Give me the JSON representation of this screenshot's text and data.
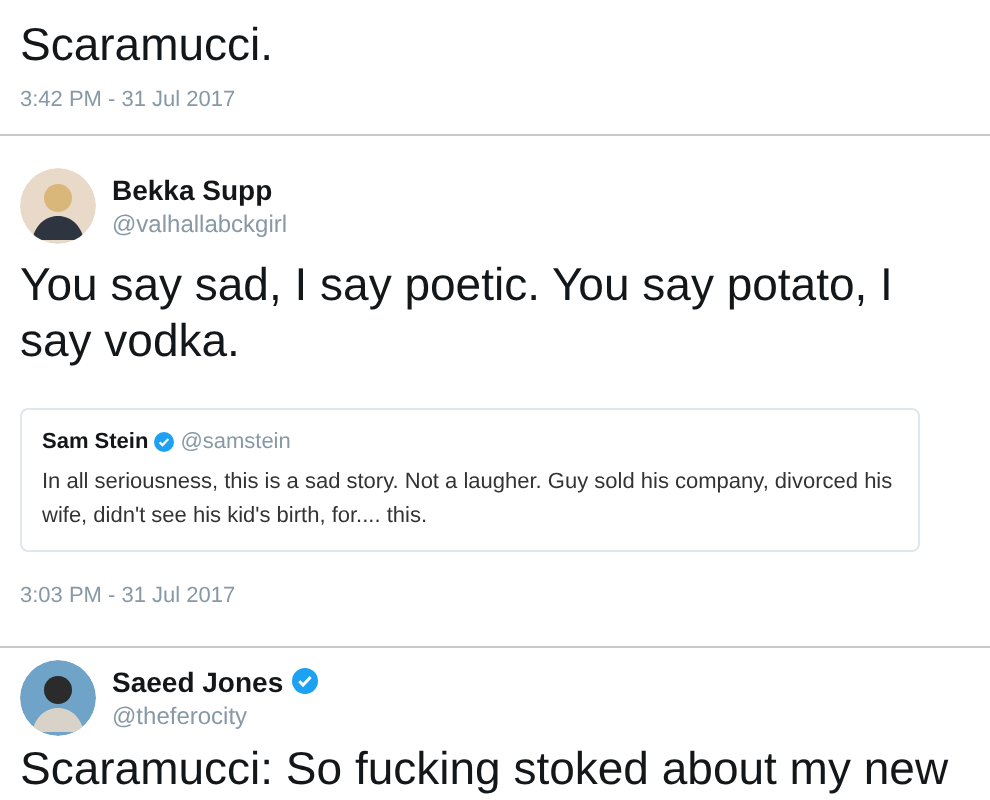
{
  "tweets": [
    {
      "text": "Scaramucci.",
      "time": "3:42 PM - 31 Jul 2017"
    },
    {
      "author": {
        "name": "Bekka Supp",
        "handle": "@valhallabckgirl",
        "verified": false
      },
      "text": "You say sad, I say poetic. You say potato, I say vodka.",
      "quote": {
        "name": "Sam Stein",
        "verified": true,
        "handle": "@samstein",
        "text": "In all seriousness, this is a sad story. Not a laugher. Guy sold his company, divorced his wife, didn't see his kid's birth, for.... this."
      },
      "time": "3:03 PM - 31 Jul 2017"
    },
    {
      "author": {
        "name": "Saeed Jones",
        "handle": "@theferocity",
        "verified": true
      },
      "text": "Scaramucci: So fucking stoked about my new"
    }
  ]
}
